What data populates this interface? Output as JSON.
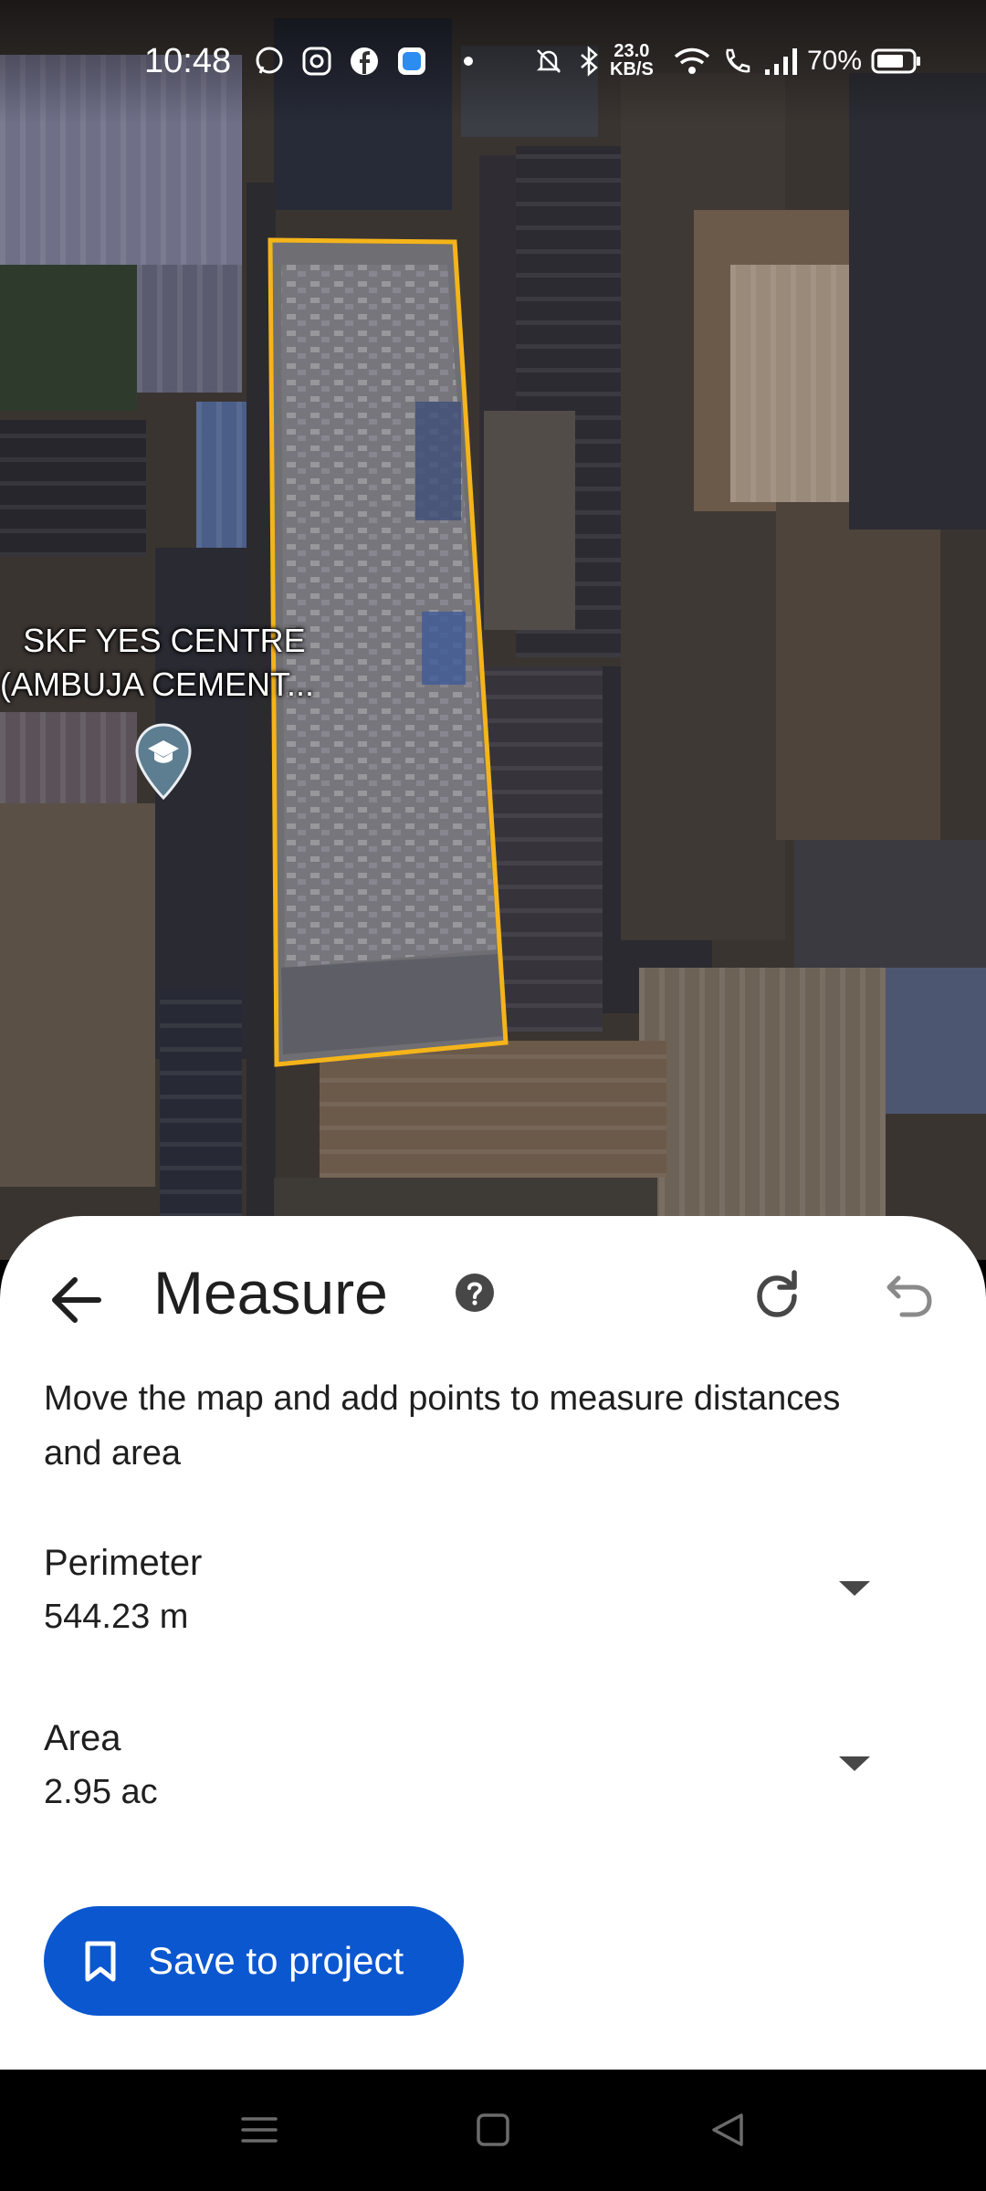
{
  "status_bar": {
    "time": "10:48",
    "speed_value": "23.0",
    "speed_unit": "KB/S",
    "battery": "70%",
    "icons": [
      "whatsapp-icon",
      "instagram-icon",
      "facebook-icon",
      "app-icon",
      "dot-icon",
      "mute-icon",
      "bluetooth-icon",
      "wifi-icon",
      "wifi-call-icon",
      "signal-icon",
      "battery-icon"
    ]
  },
  "map": {
    "place_label_line1": "SKF YES CENTRE",
    "place_label_line2": "(AMBUJA CEMENT...",
    "place_icon": "education-pin-icon",
    "outline_color": "#f4b41a"
  },
  "measure": {
    "title": "Measure",
    "instruction": "Move the map and add points to measure distances and area",
    "perimeter_label": "Perimeter",
    "perimeter_value": "544.23 m",
    "area_label": "Area",
    "area_value": "2.95 ac",
    "save_label": "Save to project",
    "accent_color": "#0b57d0"
  },
  "nav_bar": {
    "icons": [
      "recents-icon",
      "home-icon",
      "back-icon"
    ]
  }
}
